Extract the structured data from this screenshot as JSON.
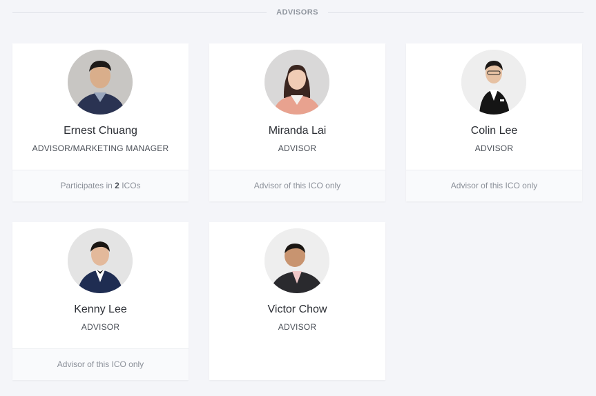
{
  "section": {
    "title": "ADVISORS"
  },
  "advisors": [
    {
      "name": "Ernest Chuang",
      "role": "ADVISOR/MARKETING MANAGER",
      "footer": {
        "prefix": "Participates in ",
        "count": "2",
        "suffix": " ICOs"
      }
    },
    {
      "name": "Miranda Lai",
      "role": "ADVISOR",
      "footer": {
        "text": "Advisor of this ICO only"
      }
    },
    {
      "name": "Colin Lee",
      "role": "ADVISOR",
      "footer": {
        "text": "Advisor of this ICO only"
      }
    },
    {
      "name": "Kenny Lee",
      "role": "ADVISOR",
      "footer": {
        "text": "Advisor of this ICO only"
      }
    },
    {
      "name": "Victor Chow",
      "role": "ADVISOR"
    }
  ]
}
